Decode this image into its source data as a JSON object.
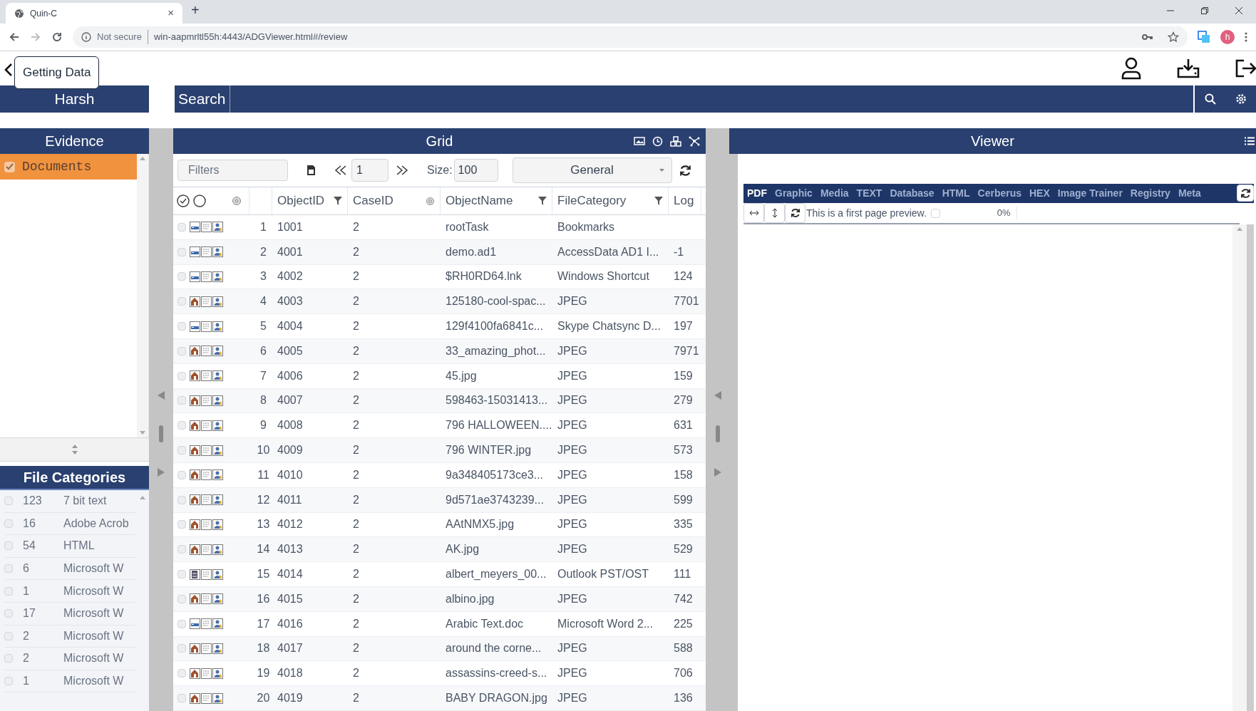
{
  "browser": {
    "tab_title": "Quin-C",
    "tab_close": "×",
    "new_tab": "+",
    "security": "Not secure",
    "url": "win-aapmrltl55h:4443/ADGViewer.html#/review",
    "profile_initial": "h"
  },
  "app": {
    "tooltip": "Getting Data",
    "user": "Harsh",
    "search_label": "Search"
  },
  "evidence": {
    "title": "Evidence",
    "items": [
      {
        "label": "Documents",
        "checked": true,
        "selected": true
      }
    ]
  },
  "file_categories": {
    "title": "File Categories",
    "rows": [
      {
        "count": "123",
        "name": "7 bit text",
        "checked": false
      },
      {
        "count": "16",
        "name": "Adobe Acrob",
        "checked": false
      },
      {
        "count": "54",
        "name": "HTML",
        "checked": false
      },
      {
        "count": "6",
        "name": "Microsoft W",
        "checked": false
      },
      {
        "count": "1",
        "name": "Microsoft W",
        "checked": false
      },
      {
        "count": "17",
        "name": "Microsoft W",
        "checked": false
      },
      {
        "count": "2",
        "name": "Microsoft W",
        "checked": false
      },
      {
        "count": "2",
        "name": "Microsoft W",
        "checked": false
      },
      {
        "count": "1",
        "name": "Microsoft W",
        "checked": false
      }
    ]
  },
  "grid": {
    "title": "Grid",
    "filters_placeholder": "Filters",
    "page": "1",
    "size_label": "Size:",
    "size": "100",
    "view": "General",
    "columns": [
      {
        "label": "ObjectID",
        "kind": "filter"
      },
      {
        "label": "CaseID",
        "kind": "settings"
      },
      {
        "label": "ObjectName",
        "kind": "filter"
      },
      {
        "label": "FileCategory",
        "kind": "filter"
      },
      {
        "label": "Log",
        "kind": "plain"
      }
    ],
    "rows": [
      {
        "index": "1",
        "kind": "drive",
        "checked": false,
        "object_id": "1001",
        "case_id": "2",
        "object_name": "rootTask",
        "file_category": "Bookmarks"
      },
      {
        "index": "2",
        "kind": "drive",
        "checked": false,
        "object_id": "4001",
        "case_id": "2",
        "object_name": "demo.ad1",
        "file_category": "AccessData AD1 I...",
        "log": "-1"
      },
      {
        "index": "3",
        "kind": "drive",
        "checked": false,
        "object_id": "4002",
        "case_id": "2",
        "object_name": "$RH0RD64.lnk",
        "file_category": "Windows Shortcut",
        "log": "124"
      },
      {
        "index": "4",
        "kind": "photo",
        "checked": false,
        "object_id": "4003",
        "case_id": "2",
        "object_name": "125180-cool-spac...",
        "file_category": "JPEG",
        "log": "7701"
      },
      {
        "index": "5",
        "kind": "drive",
        "checked": false,
        "object_id": "4004",
        "case_id": "2",
        "object_name": "129f4100fa6841c...",
        "file_category": "Skype Chatsync D...",
        "log": "197"
      },
      {
        "index": "6",
        "kind": "photo",
        "checked": false,
        "object_id": "4005",
        "case_id": "2",
        "object_name": "33_amazing_phot...",
        "file_category": "JPEG",
        "log": "7971"
      },
      {
        "index": "7",
        "kind": "photo",
        "checked": false,
        "object_id": "4006",
        "case_id": "2",
        "object_name": "45.jpg",
        "file_category": "JPEG",
        "log": "159"
      },
      {
        "index": "8",
        "kind": "photo",
        "checked": false,
        "object_id": "4007",
        "case_id": "2",
        "object_name": "598463-15031413...",
        "file_category": "JPEG",
        "log": "279"
      },
      {
        "index": "9",
        "kind": "photo",
        "checked": false,
        "object_id": "4008",
        "case_id": "2",
        "object_name": "796 HALLOWEEN....",
        "file_category": "JPEG",
        "log": "631"
      },
      {
        "index": "10",
        "kind": "photo",
        "checked": false,
        "object_id": "4009",
        "case_id": "2",
        "object_name": "796 WINTER.jpg",
        "file_category": "JPEG",
        "log": "573"
      },
      {
        "index": "11",
        "kind": "photo",
        "checked": false,
        "object_id": "4010",
        "case_id": "2",
        "object_name": "9a348405173ce3...",
        "file_category": "JPEG",
        "log": "158"
      },
      {
        "index": "12",
        "kind": "photo",
        "checked": false,
        "object_id": "4011",
        "case_id": "2",
        "object_name": "9d571ae3743239...",
        "file_category": "JPEG",
        "log": "599"
      },
      {
        "index": "13",
        "kind": "photo",
        "checked": false,
        "object_id": "4012",
        "case_id": "2",
        "object_name": "AAtNMX5.jpg",
        "file_category": "JPEG",
        "log": "335"
      },
      {
        "index": "14",
        "kind": "photo",
        "checked": false,
        "object_id": "4013",
        "case_id": "2",
        "object_name": "AK.jpg",
        "file_category": "JPEG",
        "log": "529"
      },
      {
        "index": "15",
        "kind": "mailbox",
        "checked": false,
        "object_id": "4014",
        "case_id": "2",
        "object_name": "albert_meyers_00...",
        "file_category": "Outlook PST/OST",
        "log": "111"
      },
      {
        "index": "16",
        "kind": "photo",
        "checked": false,
        "object_id": "4015",
        "case_id": "2",
        "object_name": "albino.jpg",
        "file_category": "JPEG",
        "log": "742"
      },
      {
        "index": "17",
        "kind": "drive",
        "checked": false,
        "object_id": "4016",
        "case_id": "2",
        "object_name": "Arabic Text.doc",
        "file_category": "Microsoft Word 2...",
        "log": "225"
      },
      {
        "index": "18",
        "kind": "photo",
        "checked": false,
        "object_id": "4017",
        "case_id": "2",
        "object_name": "around the corne...",
        "file_category": "JPEG",
        "log": "588"
      },
      {
        "index": "19",
        "kind": "photo",
        "checked": false,
        "object_id": "4018",
        "case_id": "2",
        "object_name": "assassins-creed-s...",
        "file_category": "JPEG",
        "log": "706"
      },
      {
        "index": "20",
        "kind": "photo",
        "checked": false,
        "object_id": "4019",
        "case_id": "2",
        "object_name": "BABY DRAGON.jpg",
        "file_category": "JPEG",
        "log": "136"
      }
    ]
  },
  "viewer": {
    "title": "Viewer",
    "tabs": [
      {
        "label": "PDF",
        "selected": true
      },
      {
        "label": "Graphic",
        "selected": false
      },
      {
        "label": "Media",
        "selected": false
      },
      {
        "label": "TEXT",
        "selected": false
      },
      {
        "label": "Database",
        "selected": false
      },
      {
        "label": "HTML",
        "selected": false
      },
      {
        "label": "Cerberus",
        "selected": false
      },
      {
        "label": "HEX",
        "selected": false
      },
      {
        "label": "Image Trainer",
        "selected": false
      },
      {
        "label": "Registry",
        "selected": false
      },
      {
        "label": "Meta",
        "selected": false
      }
    ],
    "preview_text": "This is a first page preview.",
    "preview_checked": false,
    "progress": "0%"
  }
}
